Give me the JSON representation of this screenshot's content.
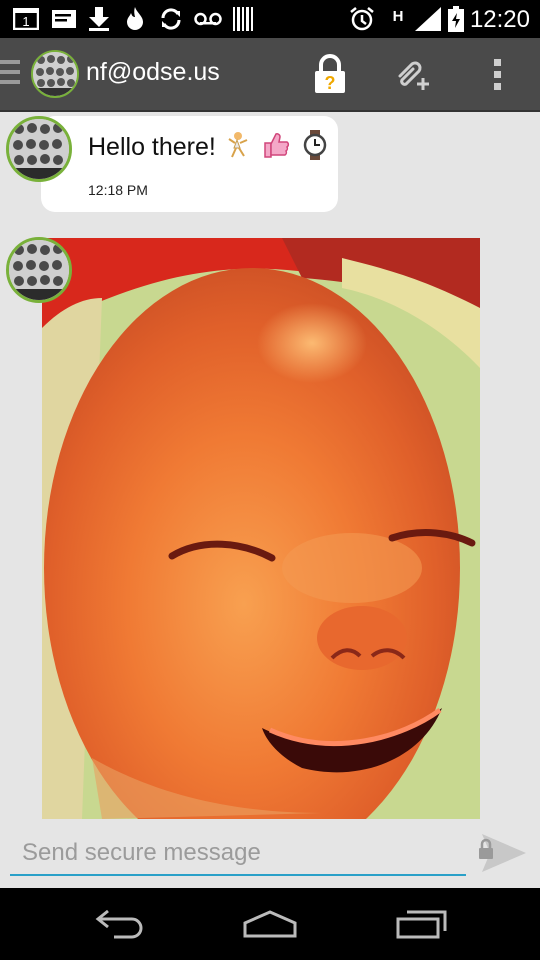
{
  "status_bar": {
    "time": "12:20",
    "notification_icons": [
      "calendar-1-icon",
      "message-icon",
      "download-icon",
      "flame-icon",
      "sync-icon",
      "voicemail-icon",
      "barcode-icon"
    ],
    "calendar_day": "1",
    "system_icons": [
      "alarm-icon",
      "h-signal-icon",
      "cell-signal-icon",
      "battery-charging-icon"
    ],
    "network_type": "H"
  },
  "action_bar": {
    "title": "nf@odse.us",
    "lock_badge": "?",
    "icons": [
      "hamburger-icon",
      "lock-icon",
      "attach-icon",
      "overflow-menu-icon"
    ]
  },
  "messages": [
    {
      "type": "text",
      "text": "Hello there!",
      "emoji": [
        "dancer-emoji",
        "thumbs-up-emoji",
        "watch-emoji"
      ],
      "time": "12:18 PM"
    },
    {
      "type": "image",
      "description_icon": "photo"
    }
  ],
  "composer": {
    "placeholder": "Send secure message",
    "value": ""
  },
  "colors": {
    "status_bar_bg": "#000000",
    "action_bar_bg": "#4a4a4a",
    "chat_bg": "#e5e5e5",
    "avatar_ring": "#79b13a",
    "input_underline": "#2aa0c8",
    "lock_badge": "#f0a800"
  }
}
